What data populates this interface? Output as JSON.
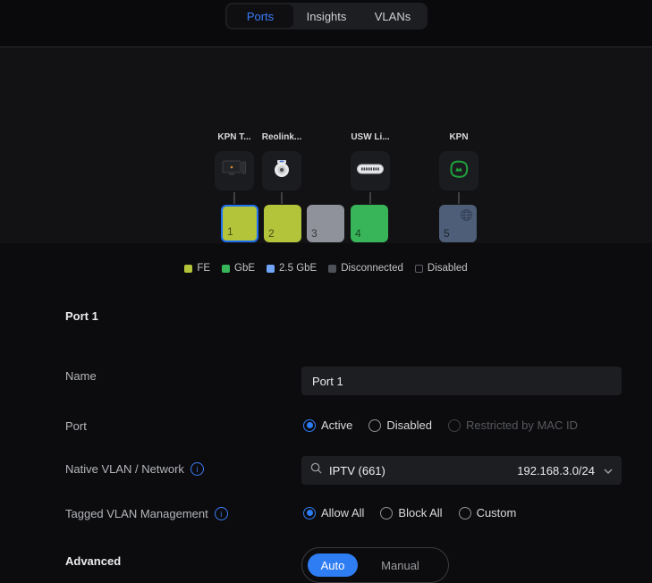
{
  "tabs": [
    {
      "label": "Ports",
      "active": true
    },
    {
      "label": "Insights",
      "active": false
    },
    {
      "label": "VLANs",
      "active": false
    }
  ],
  "devices": [
    {
      "label": "KPN T...",
      "icon": "tv-icon"
    },
    {
      "label": "Reolink...",
      "icon": "camera-icon"
    },
    {
      "label": "USW Li...",
      "icon": "switch-icon"
    },
    {
      "label": "KPN",
      "icon": "kpn-logo-icon"
    }
  ],
  "ports": [
    {
      "number": "1",
      "status": "FE",
      "color": "#b3c43a",
      "selected": true
    },
    {
      "number": "2",
      "status": "FE",
      "color": "#b3c43a",
      "selected": false
    },
    {
      "number": "3",
      "status": "Disconnected",
      "color": "#8f929b",
      "selected": false
    },
    {
      "number": "4",
      "status": "GbE",
      "color": "#38b559",
      "selected": false
    },
    {
      "number": "5",
      "status": "Uplink",
      "color": "#4e5d78",
      "selected": false,
      "icon": "globe-icon"
    }
  ],
  "legend": [
    {
      "label": "FE",
      "color": "#b3c43a"
    },
    {
      "label": "GbE",
      "color": "#38b559"
    },
    {
      "label": "2.5 GbE",
      "color": "#6fa4f7"
    },
    {
      "label": "Disconnected",
      "color": "#4e5157"
    },
    {
      "label": "Disabled",
      "color": "transparent"
    }
  ],
  "form": {
    "section_heading": "Port 1",
    "name_label": "Name",
    "name_value": "Port 1",
    "port_label": "Port",
    "port_options": [
      {
        "label": "Active",
        "selected": true,
        "disabled": false
      },
      {
        "label": "Disabled",
        "selected": false,
        "disabled": false
      },
      {
        "label": "Restricted by MAC ID",
        "selected": false,
        "disabled": true
      }
    ],
    "native_vlan_label": "Native VLAN / Network",
    "native_vlan_value": "IPTV (661)",
    "native_vlan_subnet": "192.168.3.0/24",
    "tagged_vlan_label": "Tagged VLAN Management",
    "tagged_options": [
      {
        "label": "Allow All",
        "selected": true
      },
      {
        "label": "Block All",
        "selected": false
      },
      {
        "label": "Custom",
        "selected": false
      }
    ],
    "advanced_label": "Advanced",
    "advanced_options": [
      {
        "label": "Auto",
        "selected": true
      },
      {
        "label": "Manual",
        "selected": false
      }
    ]
  },
  "colors": {
    "accent_blue": "#3b7cf7",
    "selected_port_border": "#1e6ff2",
    "section_bg": "#121214",
    "input_bg": "#1d1e22"
  }
}
